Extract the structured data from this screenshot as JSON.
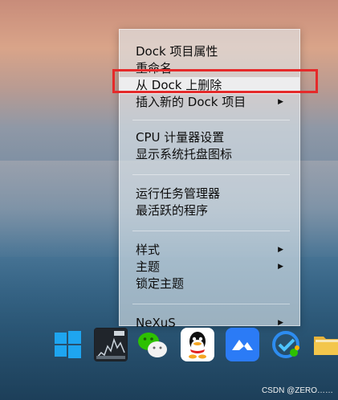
{
  "menu": {
    "items": [
      {
        "label": "Dock 项目属性",
        "submenu": false
      },
      {
        "label": "重命名",
        "submenu": false
      },
      {
        "label": "从 Dock 上删除",
        "submenu": false,
        "highlighted": true
      },
      {
        "label": "插入新的 Dock 项目",
        "submenu": true
      },
      {
        "label": "CPU 计量器设置",
        "submenu": false
      },
      {
        "label": "显示系统托盘图标",
        "submenu": false
      },
      {
        "label": "运行任务管理器",
        "submenu": false
      },
      {
        "label": "最活跃的程序",
        "submenu": false
      },
      {
        "label": "样式",
        "submenu": true
      },
      {
        "label": "主题",
        "submenu": true
      },
      {
        "label": "锁定主题",
        "submenu": false
      },
      {
        "label": "NeXuS",
        "submenu": true
      }
    ]
  },
  "dock": {
    "icons": [
      "windows-start-icon",
      "cpu-meter-icon",
      "wechat-icon",
      "qq-icon",
      "lanhu-icon",
      "dingtalk-icon",
      "folder-icon"
    ]
  },
  "watermark": "CSDN @ZERO……"
}
